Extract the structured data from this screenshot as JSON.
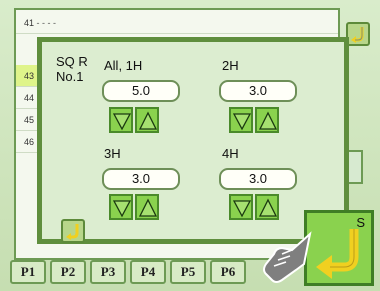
{
  "background_list": {
    "rows": [
      {
        "num": "41",
        "text": "- - - -"
      },
      {
        "num": "43",
        "text": ""
      },
      {
        "num": "44",
        "text": ""
      },
      {
        "num": "45",
        "text": ""
      },
      {
        "num": "46",
        "text": ""
      }
    ],
    "highlight_index": 1
  },
  "tabs": [
    "P1",
    "P2",
    "P3",
    "P4",
    "P5",
    "P6"
  ],
  "dialog": {
    "title_line1": "SQ R",
    "title_line2": "No.1",
    "fields": [
      {
        "label": "All, 1H",
        "value": "5.0"
      },
      {
        "label": "2H",
        "value": "3.0"
      },
      {
        "label": "3H",
        "value": "3.0"
      },
      {
        "label": "4H",
        "value": "3.0"
      }
    ]
  },
  "big_button": {
    "label": "S"
  },
  "icons": {
    "undo": "undo-arrow-icon",
    "down": "triangle-down-icon",
    "up": "triangle-up-icon",
    "pointer": "pointing-hand-icon"
  },
  "colors": {
    "accent_green": "#8ad24e",
    "border_green": "#5f8e3d",
    "undo_yellow": "#f0d020"
  }
}
